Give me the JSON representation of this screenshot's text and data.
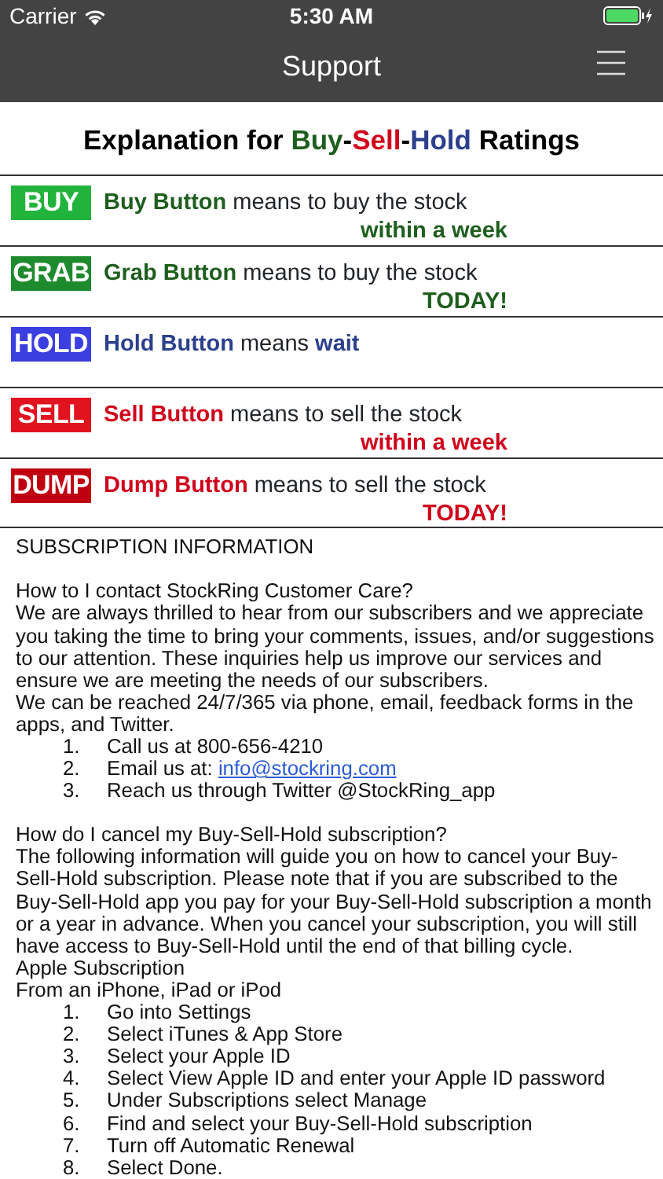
{
  "status_bar": {
    "carrier": "Carrier",
    "time": "5:30 AM"
  },
  "nav": {
    "title": "Support"
  },
  "ratings_title": [
    {
      "text": "Explanation for ",
      "kind": "plain"
    },
    {
      "text": "Buy",
      "kind": "buy"
    },
    {
      "text": "-",
      "kind": "plain"
    },
    {
      "text": "Sell",
      "kind": "sell"
    },
    {
      "text": "-",
      "kind": "plain"
    },
    {
      "text": "Hold",
      "kind": "hold"
    },
    {
      "text": " Ratings",
      "kind": "plain"
    }
  ],
  "ratings": [
    {
      "badge": "BUY",
      "color": "#22b33c",
      "kind": "buy",
      "name": "Buy Button",
      "meaning": "means to buy the stock",
      "when": "within a week"
    },
    {
      "badge": "GRAB",
      "color": "#1e8a2e",
      "kind": "buy",
      "name": "Grab Button",
      "meaning": "means to buy the stock",
      "when": "TODAY!"
    },
    {
      "badge": "HOLD",
      "color": "#3b3fe0",
      "kind": "hold",
      "name": "Hold Button",
      "meaning": "means",
      "meaning_tail": "wait"
    },
    {
      "badge": "SELL",
      "color": "#e0131e",
      "kind": "sell",
      "name": "Sell Button",
      "meaning": "means to sell the stock",
      "when": "within a week"
    },
    {
      "badge": "DUMP",
      "color": "#c00010",
      "kind": "sell",
      "name": "Dump Button",
      "meaning": "means to sell the stock",
      "when": "TODAY!"
    }
  ],
  "info": [
    {
      "kind": "text",
      "spaced": false,
      "text": "SUBSCRIPTION INFORMATION"
    },
    {
      "kind": "text",
      "spaced": true,
      "text": "How to I contact StockRing Customer Care?"
    },
    {
      "kind": "text",
      "spaced": false,
      "text": "We are always thrilled to hear from our subscribers and we appreciate you taking the time to bring your comments, issues, and/or suggestions to our attention. These inquiries help us improve our services and ensure we are meeting the needs of our subscribers."
    },
    {
      "kind": "text",
      "spaced": false,
      "text": "We can be reached 24/7/365 via phone, email, feedback forms in the apps, and Twitter."
    },
    {
      "kind": "steps",
      "spaced": false,
      "items": [
        {
          "number": "1.",
          "text": "Call us at 800-656-4210"
        },
        {
          "number": "2.",
          "text": "Email us at: ",
          "link": "info@stockring.com"
        },
        {
          "number": "3.",
          "text": "Reach us through Twitter @StockRing_app"
        }
      ]
    },
    {
      "kind": "text",
      "spaced": true,
      "text": "How do I cancel my Buy-Sell-Hold subscription?"
    },
    {
      "kind": "text",
      "spaced": false,
      "text": "The following information will guide you on how to cancel your Buy-Sell-Hold subscription. Please note that if you are subscribed to the Buy-Sell-Hold app you pay for your Buy-Sell-Hold subscription a month or a year in advance. When you cancel your subscription, you will still have access to Buy-Sell-Hold until the end of that billing cycle."
    },
    {
      "kind": "text",
      "spaced": false,
      "text": "Apple Subscription"
    },
    {
      "kind": "text",
      "spaced": false,
      "text": "From an iPhone, iPad or iPod"
    },
    {
      "kind": "steps",
      "spaced": false,
      "items": [
        {
          "number": "1.",
          "text": "Go into Settings"
        },
        {
          "number": "2.",
          "text": "Select iTunes & App Store"
        },
        {
          "number": "3.",
          "text": "Select your Apple ID"
        },
        {
          "number": "4.",
          "text": "Select View Apple ID and enter your Apple ID password"
        },
        {
          "number": "5.",
          "text": "Under Subscriptions select Manage"
        },
        {
          "number": "6.",
          "text": "Find and select your Buy-Sell-Hold subscription"
        },
        {
          "number": "7.",
          "text": "Turn off Automatic Renewal"
        },
        {
          "number": "8.",
          "text": "Select Done."
        }
      ]
    }
  ]
}
